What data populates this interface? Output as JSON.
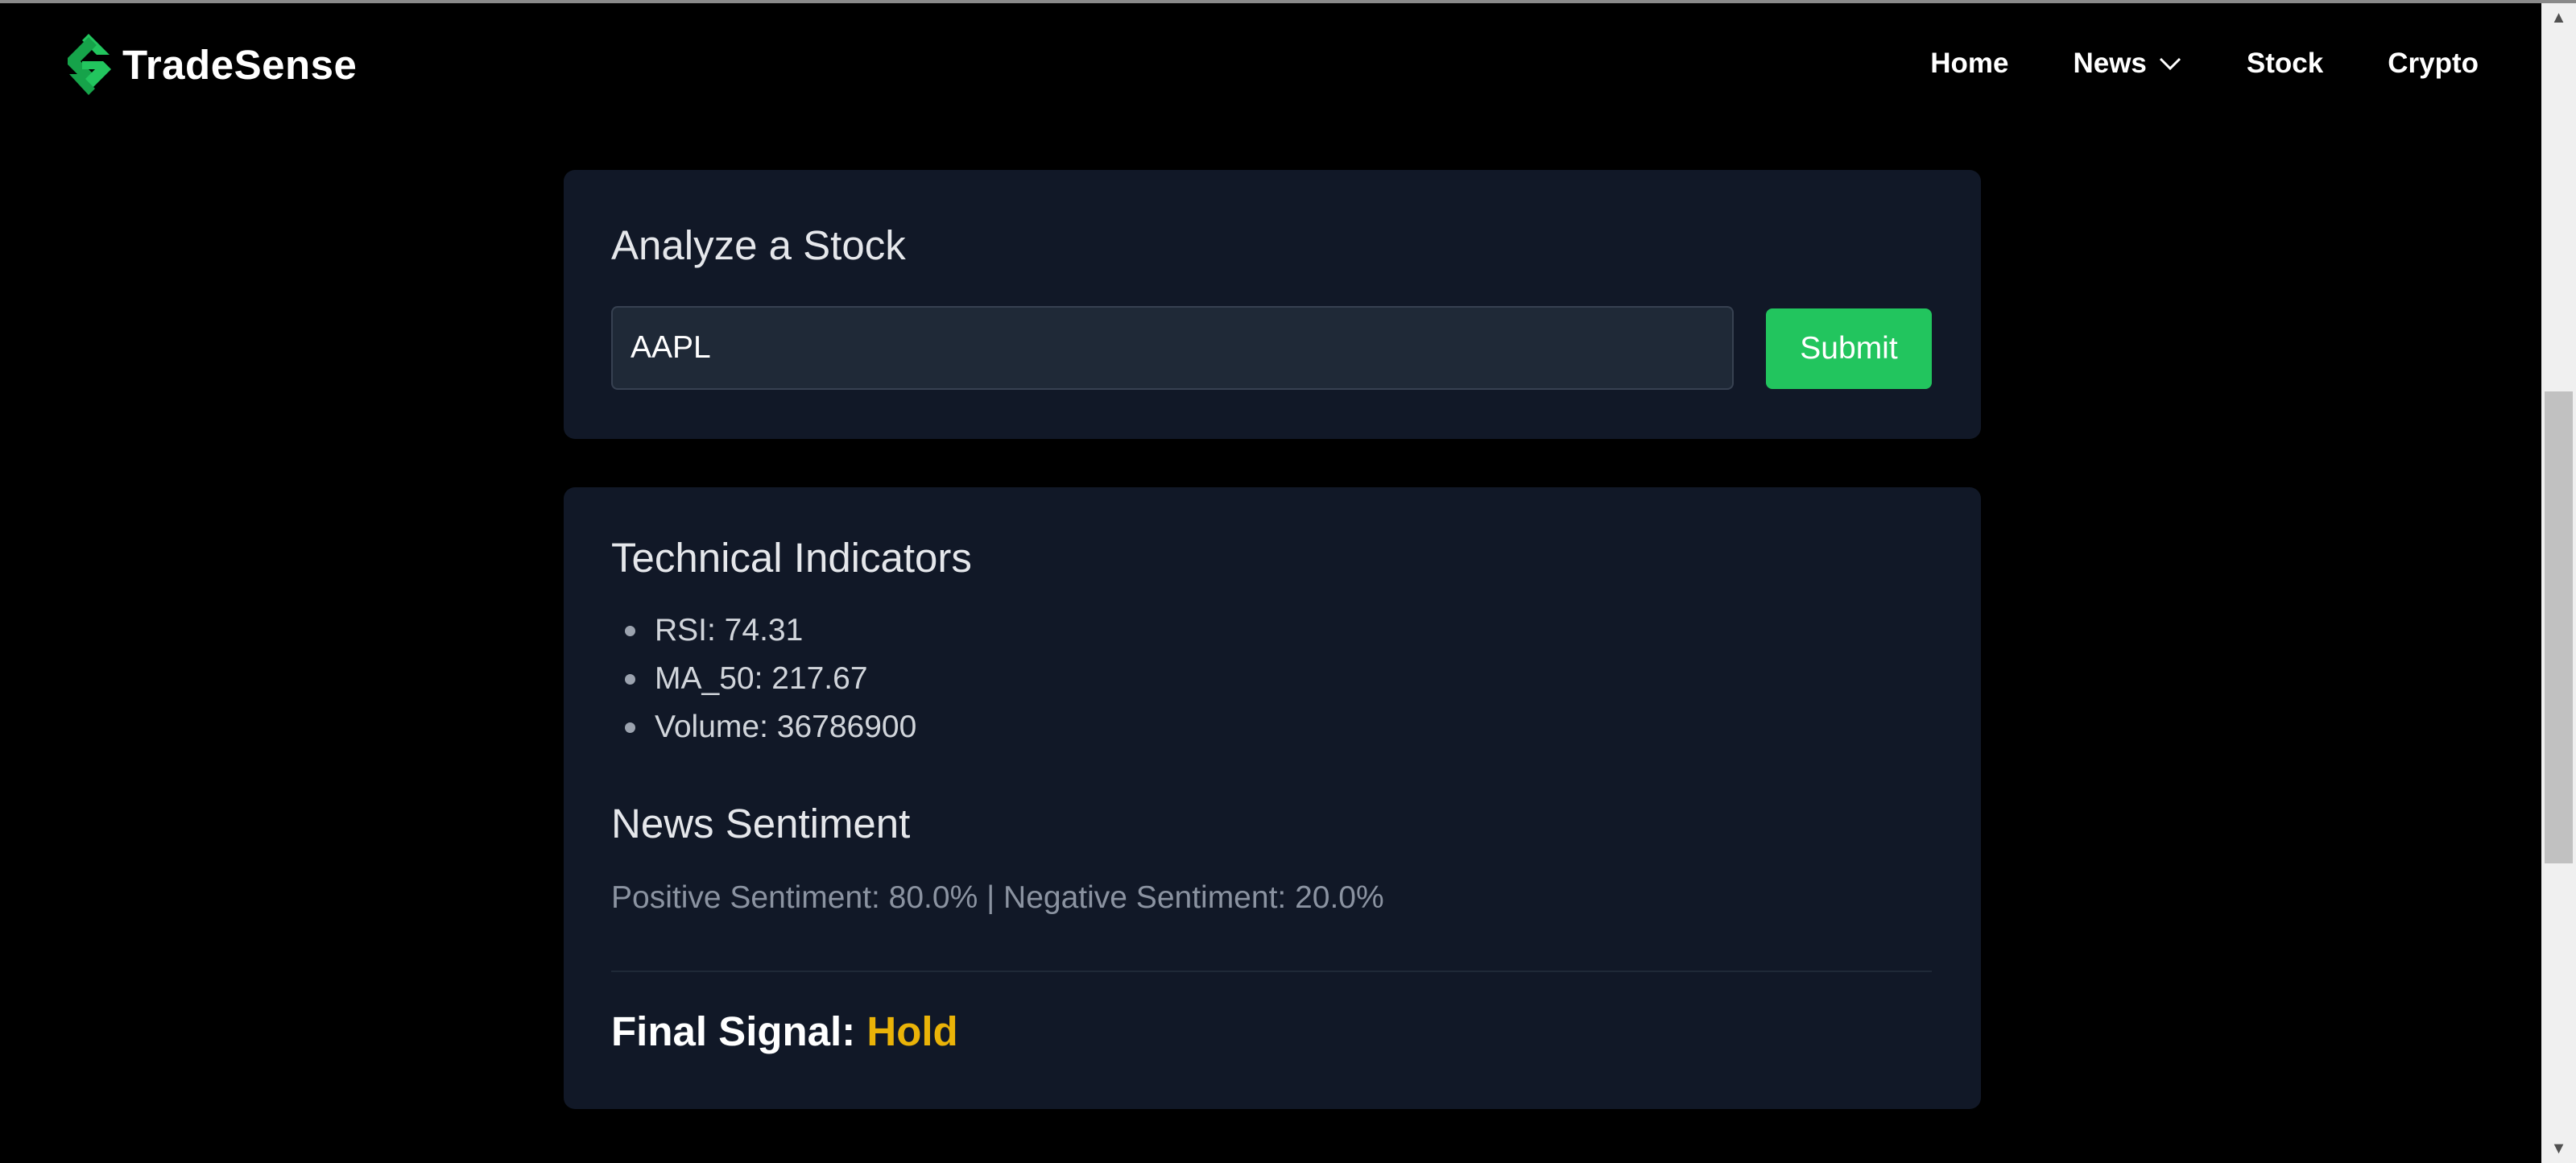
{
  "brand": {
    "name": "TradeSense",
    "color": "#22c55e"
  },
  "nav": {
    "items": [
      {
        "label": "Home"
      },
      {
        "label": "News",
        "has_dropdown": true
      },
      {
        "label": "Stock"
      },
      {
        "label": "Crypto"
      }
    ]
  },
  "analyze": {
    "title": "Analyze a Stock",
    "input_value": "AAPL",
    "submit_label": "Submit"
  },
  "indicators": {
    "title": "Technical Indicators",
    "items": [
      {
        "text": "RSI: 74.31"
      },
      {
        "text": "MA_50: 217.67"
      },
      {
        "text": "Volume: 36786900"
      }
    ]
  },
  "sentiment": {
    "title": "News Sentiment",
    "text": "Positive Sentiment: 80.0% | Negative Sentiment: 20.0%"
  },
  "final_signal": {
    "label": "Final Signal:",
    "value": "Hold",
    "value_color": "#eab308"
  },
  "colors": {
    "background": "#000000",
    "card": "#111827",
    "accent": "#22c55e"
  }
}
